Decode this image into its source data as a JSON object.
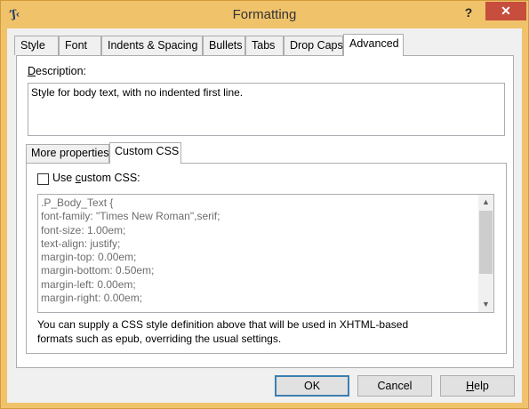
{
  "window": {
    "title": "Formatting",
    "help_label": "?",
    "close_label": "✕"
  },
  "tabs": [
    {
      "label": "Style"
    },
    {
      "label": "Font"
    },
    {
      "label": "Indents & Spacing"
    },
    {
      "label": "Bullets"
    },
    {
      "label": "Tabs"
    },
    {
      "label": "Drop Caps"
    },
    {
      "label": "Advanced",
      "active": true
    }
  ],
  "advanced": {
    "description_label_prefix": "D",
    "description_label_rest": "escription:",
    "description_value": "Style for body text, with no indented first line.",
    "inner_tabs": [
      {
        "label": "More properties"
      },
      {
        "label": "Custom CSS",
        "active": true
      }
    ],
    "custom_css": {
      "checkbox_label_pre": "Use ",
      "checkbox_label_underline": "c",
      "checkbox_label_post": "ustom CSS:",
      "checked": false,
      "lines": [
        ".P_Body_Text {",
        "font-family: \"Times New Roman\",serif;",
        "font-size: 1.00em;",
        "text-align: justify;",
        "margin-top: 0.00em;",
        "margin-bottom: 0.50em;",
        "margin-left: 0.00em;",
        "margin-right: 0.00em;"
      ],
      "hint_line1": "You can supply a CSS style definition above that will be used in XHTML-based",
      "hint_line2": "formats such as epub, overriding the usual settings."
    }
  },
  "buttons": {
    "ok": "OK",
    "cancel": "Cancel",
    "help_underline": "H",
    "help_rest": "elp"
  },
  "icons": {
    "app": "sigil-j-icon",
    "scroll_up": "chevron-up-icon",
    "scroll_down": "chevron-down-icon"
  }
}
